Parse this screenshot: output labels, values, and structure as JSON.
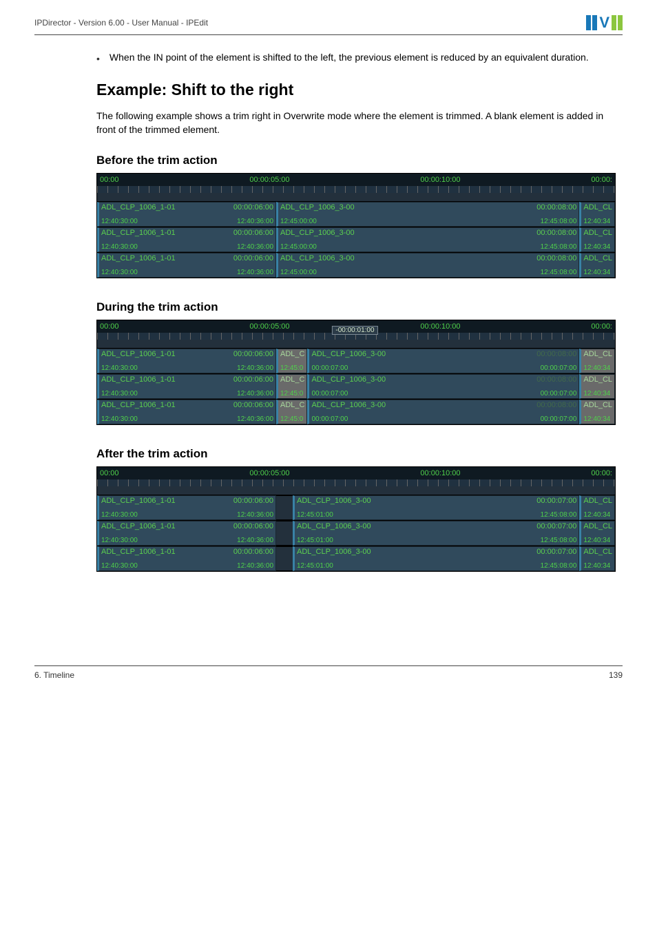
{
  "header": {
    "breadcrumb": "IPDirector - Version 6.00 - User Manual - IPEdit"
  },
  "bullet": "When the IN point of the element is shifted to the left, the previous element is reduced by an equivalent duration.",
  "section_title": "Example: Shift to the right",
  "section_para": "The following example shows a trim right in Overwrite mode where the element is trimmed. A blank element is added in front of the trimmed element.",
  "subtitles": {
    "before": "Before the trim action",
    "during": "During the trim action",
    "after": "After the trim action"
  },
  "ruler": {
    "t0": "00:00",
    "t1": "00:00:05:00",
    "t2": "00:00:10:00",
    "t3": "00:00:",
    "cursor": "-00:00:01:00"
  },
  "before": {
    "left": {
      "name": "ADL_CLP_1006_1-01",
      "dur": "00:00:06:00",
      "in": "12:40:30:00",
      "out": "12:40:36:00"
    },
    "right": {
      "name": "ADL_CLP_1006_3-00",
      "dur": "00:00:08:00",
      "in": "12:45:00:00",
      "out": "12:45:08:00"
    },
    "frag": {
      "name": "ADL_CL",
      "bot": "12:40:34"
    }
  },
  "during": {
    "left": {
      "name": "ADL_CLP_1006_1-01",
      "dur": "00:00:06:00",
      "in": "12:40:30:00",
      "out": "12:40:36:00"
    },
    "mid": {
      "name": "ADL_C",
      "bot": "12:45:0"
    },
    "right": {
      "name": "ADL_CLP_1006_3-00",
      "dur_dim": "00:00:08:00",
      "dur_new": "00:00:07:00",
      "in": "00:00:07:00",
      "out_top": "00:00:07:00"
    },
    "frag": {
      "name": "ADL_CL",
      "bot": "12:40:34"
    }
  },
  "after": {
    "left": {
      "name": "ADL_CLP_1006_1-01",
      "dur": "00:00:06:00",
      "in": "12:40:30:00",
      "out": "12:40:36:00"
    },
    "right": {
      "name": "ADL_CLP_1006_3-00",
      "dur": "00:00:07:00",
      "in": "12:45:01:00",
      "out": "12:45:08:00"
    },
    "frag": {
      "name": "ADL_CL",
      "bot": "12:40:34"
    }
  },
  "footer": {
    "left": "6. Timeline",
    "right": "139"
  }
}
